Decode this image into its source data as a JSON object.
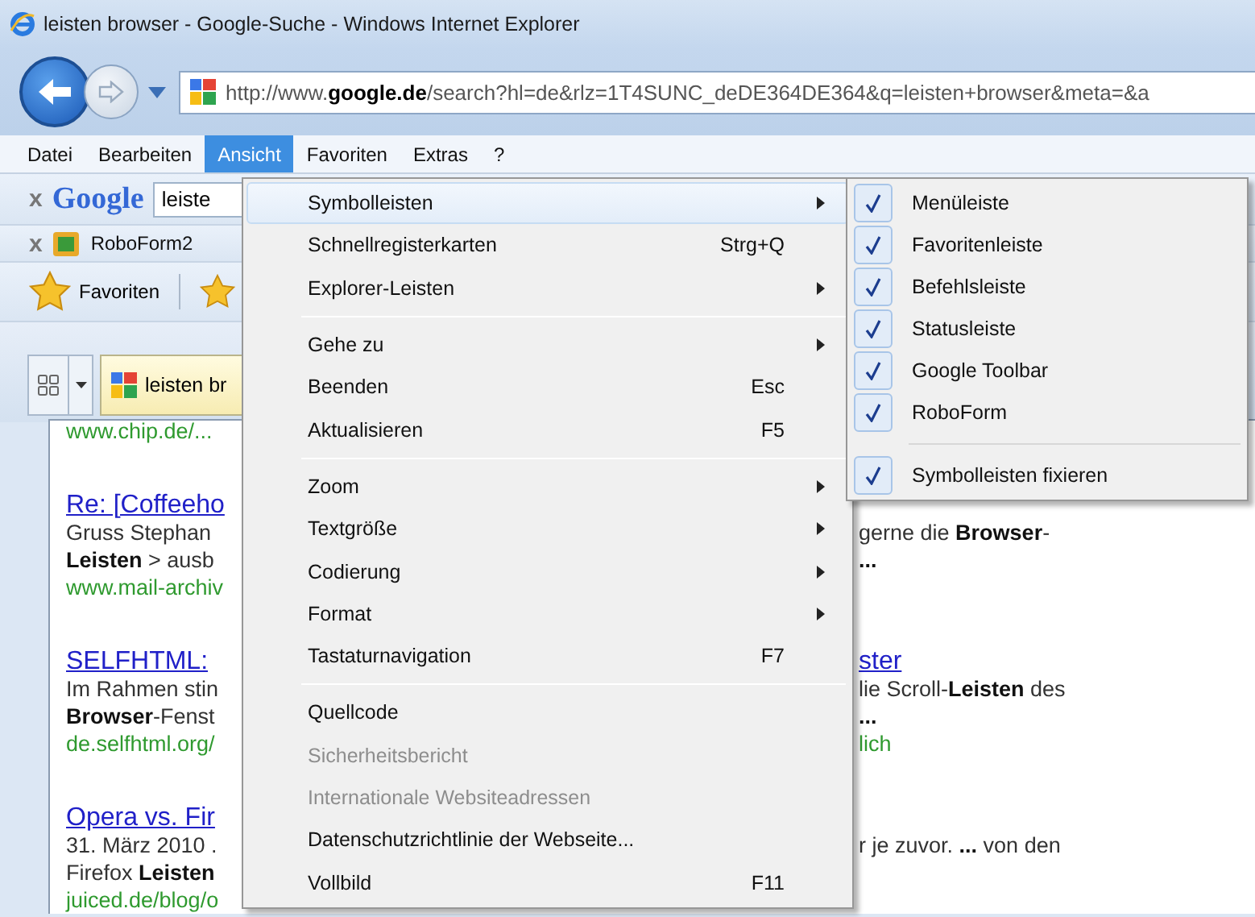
{
  "window": {
    "title": "leisten browser - Google-Suche - Windows Internet Explorer"
  },
  "navigation": {
    "url": "http://www.**google.de**/search?hl=de&rlz=1T4SUNC_deDE364DE364&q=leisten+browser&meta=&a"
  },
  "menu_bar": [
    {
      "label": "Datei",
      "selected": false
    },
    {
      "label": "Bearbeiten",
      "selected": false
    },
    {
      "label": "Ansicht",
      "selected": true
    },
    {
      "label": "Favoriten",
      "selected": false
    },
    {
      "label": "Extras",
      "selected": false
    },
    {
      "label": "?",
      "selected": false
    }
  ],
  "google_toolbar": {
    "close": "x",
    "logo": "Google",
    "search_value": "leiste"
  },
  "roboform_toolbar": {
    "close": "x",
    "label": "RoboForm2"
  },
  "favorites_bar": {
    "label": "Favoriten"
  },
  "tabs": [
    {
      "label": "leisten br",
      "selected": true
    }
  ],
  "results": [
    {
      "lines": [
        {
          "kind": "url",
          "left": "www.chip.de/..."
        }
      ]
    },
    {
      "lines": [
        {
          "kind": "link",
          "left": "Re: [Coffeeho"
        },
        {
          "kind": "text",
          "left": "Gruss Stephan",
          "right": "gerne die **Browser**-"
        },
        {
          "kind": "text",
          "left": "**Leisten** > ausb",
          "right": "**...**"
        },
        {
          "kind": "url",
          "left": "www.mail-archiv"
        }
      ]
    },
    {
      "lines": [
        {
          "kind": "link",
          "left": "SELFHTML:",
          "right": "ster"
        },
        {
          "kind": "text",
          "left": "Im Rahmen stin",
          "right": "lie Scroll-**Leisten** des"
        },
        {
          "kind": "text",
          "left": "**Browser**-Fenst",
          "right": "**...**"
        },
        {
          "kind": "url",
          "left": "de.selfhtml.org/",
          "right": "lich"
        }
      ]
    },
    {
      "lines": [
        {
          "kind": "link",
          "left": "Opera vs. Fir"
        },
        {
          "kind": "text",
          "left": "31. März 2010 .",
          "right": "r je zuvor. **...** von den"
        },
        {
          "kind": "text",
          "left": "Firefox **Leisten**"
        },
        {
          "kind": "url",
          "left": "juiced.de/blog/o"
        }
      ]
    }
  ],
  "view_menu": {
    "groups": [
      [
        {
          "label": "Symbolleisten",
          "submenu": true,
          "disabled": false,
          "selected": true
        },
        {
          "label": "Schnellregisterkarten",
          "shortcut": "Strg+Q",
          "submenu": false,
          "disabled": false,
          "selected": false
        },
        {
          "label": "Explorer-Leisten",
          "submenu": true,
          "disabled": false,
          "selected": false
        }
      ],
      [
        {
          "label": "Gehe zu",
          "submenu": true,
          "disabled": false,
          "selected": false
        },
        {
          "label": "Beenden",
          "shortcut": "Esc",
          "submenu": false,
          "disabled": false,
          "selected": false
        },
        {
          "label": "Aktualisieren",
          "shortcut": "F5",
          "submenu": false,
          "disabled": false,
          "selected": false
        }
      ],
      [
        {
          "label": "Zoom",
          "submenu": true,
          "disabled": false,
          "selected": false
        },
        {
          "label": "Textgröße",
          "submenu": true,
          "disabled": false,
          "selected": false
        },
        {
          "label": "Codierung",
          "submenu": true,
          "disabled": false,
          "selected": false
        },
        {
          "label": "Format",
          "submenu": true,
          "disabled": false,
          "selected": false
        },
        {
          "label": "Tastaturnavigation",
          "shortcut": "F7",
          "submenu": false,
          "disabled": false,
          "selected": false
        }
      ],
      [
        {
          "label": "Quellcode",
          "submenu": false,
          "disabled": false,
          "selected": false
        },
        {
          "label": "Sicherheitsbericht",
          "submenu": false,
          "disabled": true,
          "selected": false
        },
        {
          "label": "Internationale Websiteadressen",
          "submenu": false,
          "disabled": true,
          "selected": false
        },
        {
          "label": "Datenschutzrichtlinie der Webseite...",
          "submenu": false,
          "disabled": false,
          "selected": false
        },
        {
          "label": "Vollbild",
          "shortcut": "F11",
          "submenu": false,
          "disabled": false,
          "selected": false
        }
      ]
    ]
  },
  "toolbars_submenu": {
    "groups": [
      [
        {
          "label": "Menüleiste",
          "checked": true
        },
        {
          "label": "Favoritenleiste",
          "checked": true
        },
        {
          "label": "Befehlsleiste",
          "checked": true
        },
        {
          "label": "Statusleiste",
          "checked": true
        },
        {
          "label": "Google Toolbar",
          "checked": true
        },
        {
          "label": "RoboForm",
          "checked": true
        }
      ],
      [
        {
          "label": "Symbolleisten fixieren",
          "checked": true
        }
      ]
    ]
  }
}
